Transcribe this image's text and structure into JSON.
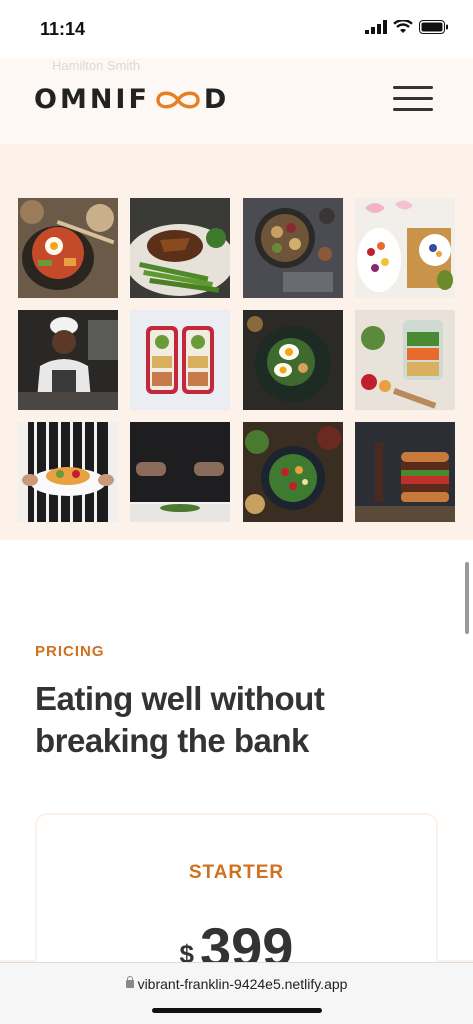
{
  "status_bar": {
    "time": "11:14"
  },
  "header": {
    "logo_prefix": "OMNIF",
    "logo_suffix": "D",
    "ghost_text": "Hamilton Smith"
  },
  "gallery": {
    "items": [
      "korean-bibimbap-bowl",
      "steak-with-asparagus",
      "dark-bowl-platter",
      "fruit-breakfast-spread",
      "chef-cooking",
      "meal-prep-containers",
      "egg-salad-plate",
      "jar-salad-ingredients",
      "chef-holding-plate",
      "chef-plating-dish",
      "mixed-salad-bowls",
      "stacked-burger"
    ]
  },
  "pricing": {
    "subheading": "PRICING",
    "heading": "Eating well without breaking the bank",
    "plan": {
      "name": "STARTER",
      "currency": "$",
      "price": "399"
    }
  },
  "browser": {
    "url": "vibrant-franklin-9424e5.netlify.app"
  },
  "colors": {
    "accent": "#cf711f",
    "section_bg": "#fdf2e9",
    "text": "#333333"
  }
}
